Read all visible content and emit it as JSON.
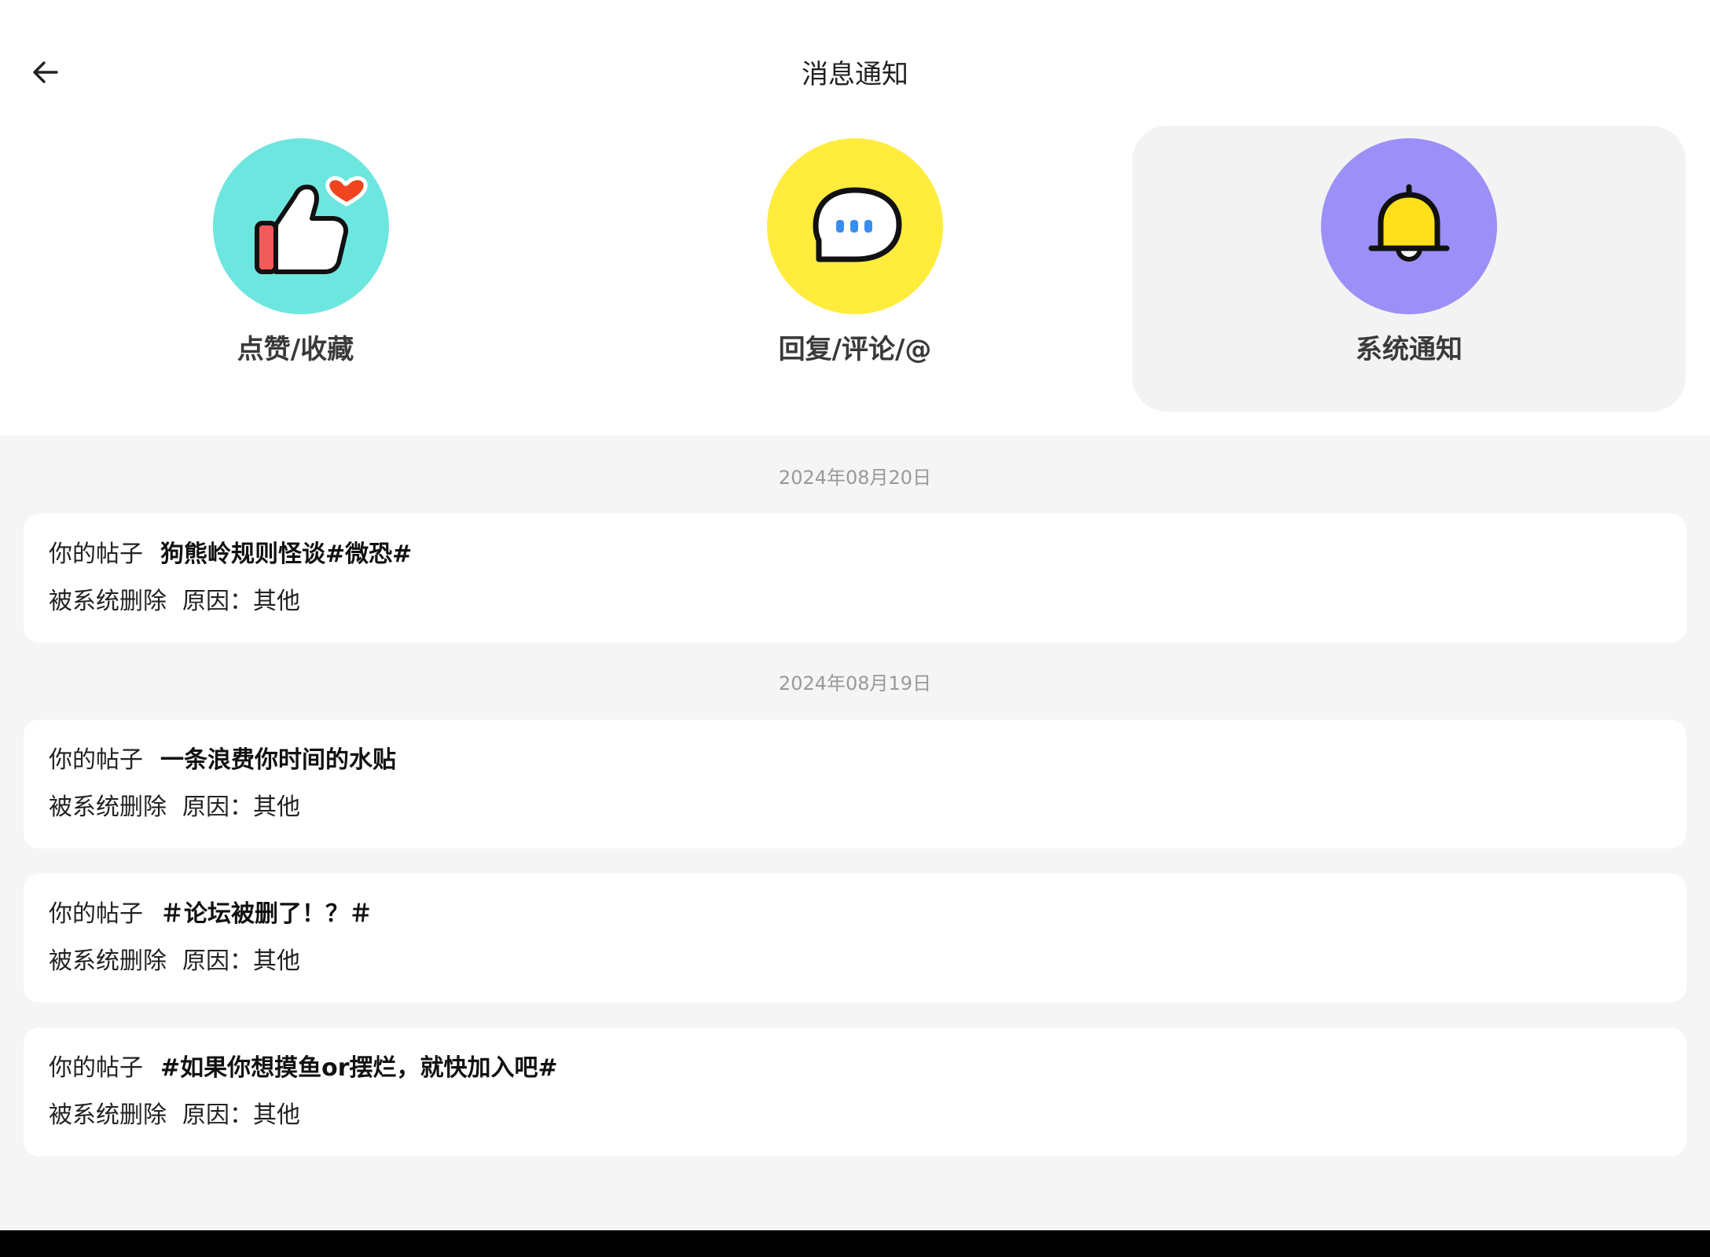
{
  "header": {
    "title": "消息通知"
  },
  "categories": [
    {
      "label": "点赞/收藏",
      "icon": "thumbs-up-heart-icon",
      "color": "#6ee6e0",
      "active": false
    },
    {
      "label": "回复/评论/@",
      "icon": "chat-bubble-icon",
      "color": "#ffec3d",
      "active": false
    },
    {
      "label": "系统通知",
      "icon": "bell-icon",
      "color": "#9c8ff7",
      "active": true
    }
  ],
  "groups": [
    {
      "date": "2024年08月20日",
      "items": [
        {
          "prefix": "你的帖子",
          "title": "狗熊岭规则怪谈#微恐#",
          "status": "被系统删除",
          "reason": "原因：其他"
        }
      ]
    },
    {
      "date": "2024年08月19日",
      "items": [
        {
          "prefix": "你的帖子",
          "title": "一条浪费你时间的水贴",
          "status": "被系统删除",
          "reason": "原因：其他"
        },
        {
          "prefix": "你的帖子",
          "title": "＃论坛被删了！？＃",
          "status": "被系统删除",
          "reason": "原因：其他"
        },
        {
          "prefix": "你的帖子",
          "title": "#如果你想摸鱼or摆烂，就快加入吧#",
          "status": "被系统删除",
          "reason": "原因：其他"
        }
      ]
    }
  ]
}
